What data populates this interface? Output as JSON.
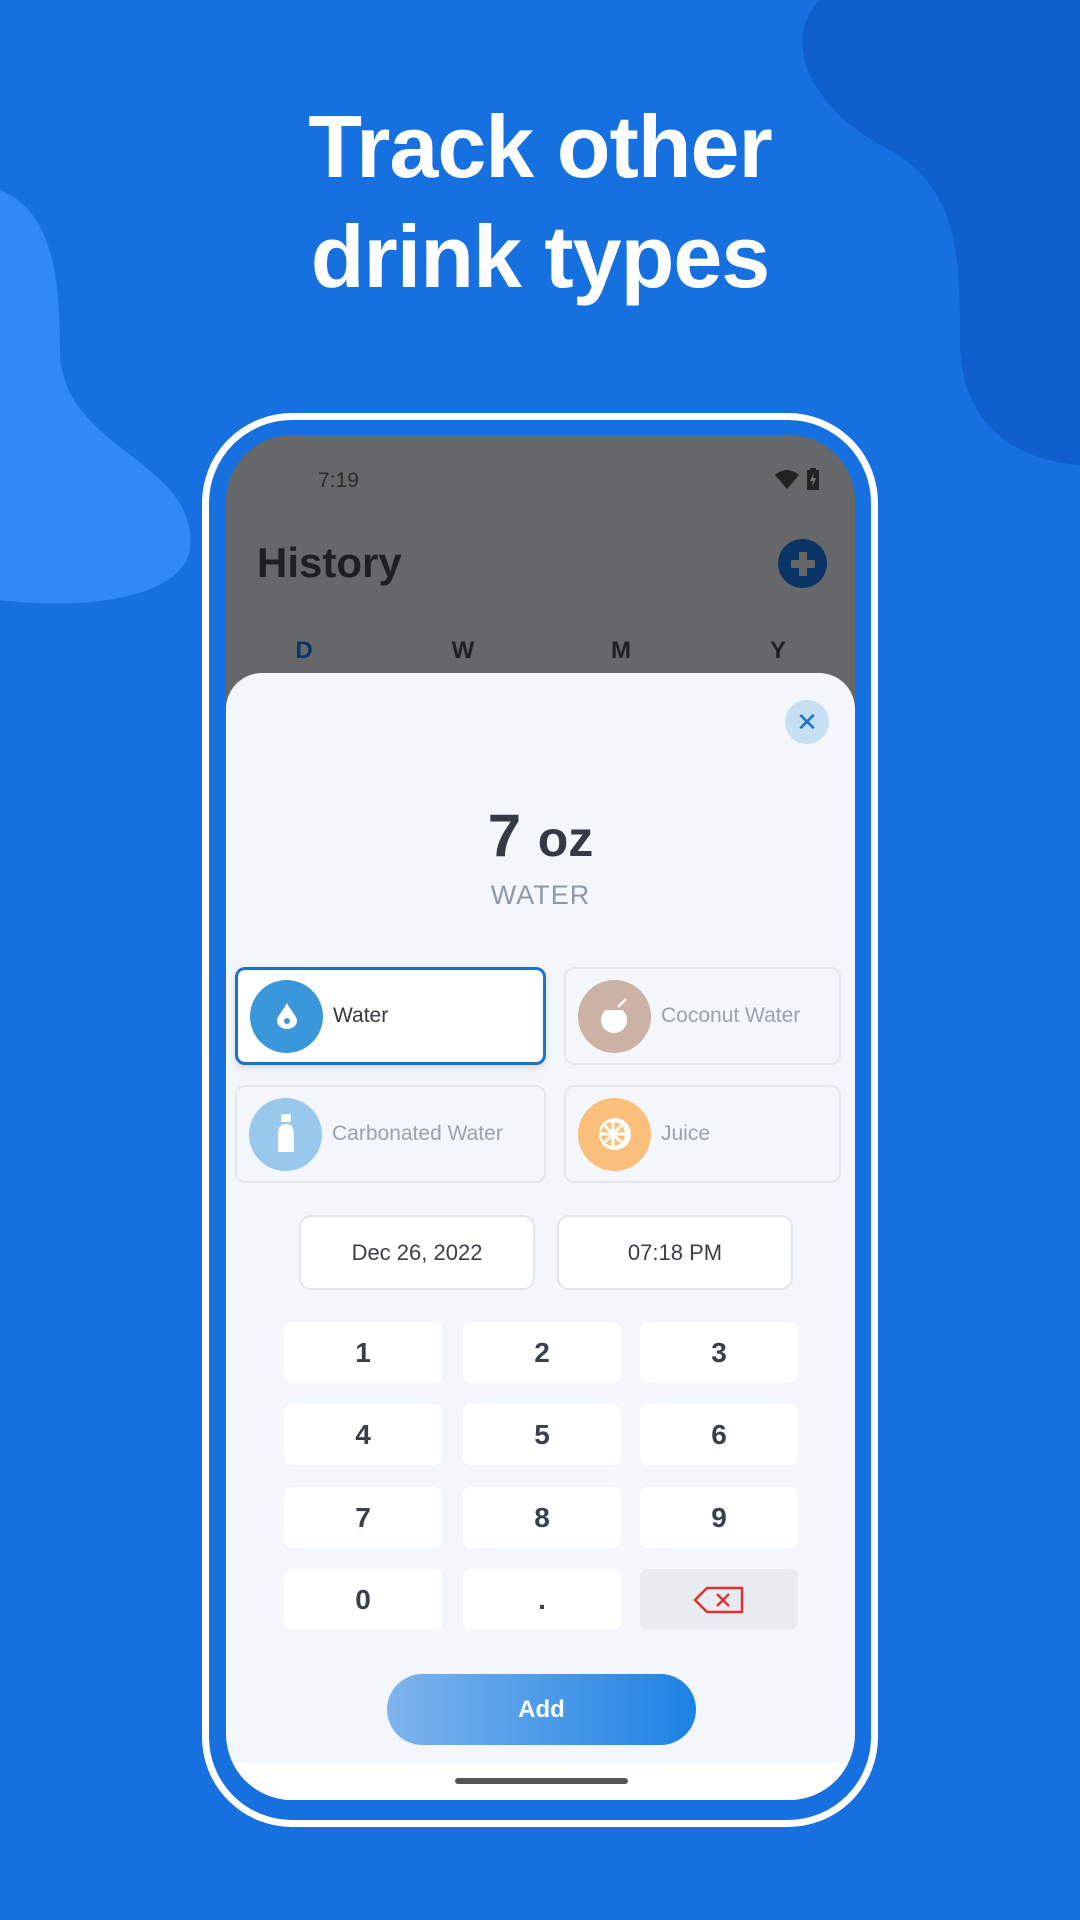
{
  "headline": {
    "line1": "Track other",
    "line2": "drink types"
  },
  "colors": {
    "background": "#1670e0",
    "accent": "#1873cc",
    "add_button": "#1c82e4"
  },
  "status_bar": {
    "time": "7:19",
    "icons": [
      "wifi-icon",
      "battery-charging-icon"
    ]
  },
  "app": {
    "title": "History",
    "add_icon": "plus-circle-icon",
    "tabs": [
      {
        "label": "D",
        "active": true
      },
      {
        "label": "W",
        "active": false
      },
      {
        "label": "M",
        "active": false
      },
      {
        "label": "Y",
        "active": false
      }
    ]
  },
  "sheet": {
    "close_icon": "close-icon",
    "amount_value": "7",
    "amount_unit": "oz",
    "drink_type": "WATER",
    "drinks": [
      {
        "label": "Water",
        "icon": "water-drop-icon",
        "color": "#3a97da",
        "selected": true
      },
      {
        "label": "Coconut Water",
        "icon": "coconut-icon",
        "color": "#cbb2a4",
        "selected": false
      },
      {
        "label": "Carbonated Water",
        "icon": "bottle-icon",
        "color": "#98c8ec",
        "selected": false
      },
      {
        "label": "Juice",
        "icon": "orange-slice-icon",
        "color": "#fbbf7c",
        "selected": false
      }
    ],
    "date": "Dec 26, 2022",
    "time": "07:18 PM",
    "keypad": [
      "1",
      "2",
      "3",
      "4",
      "5",
      "6",
      "7",
      "8",
      "9",
      "0",
      "."
    ],
    "backspace_icon": "backspace-icon",
    "add_label": "Add"
  }
}
